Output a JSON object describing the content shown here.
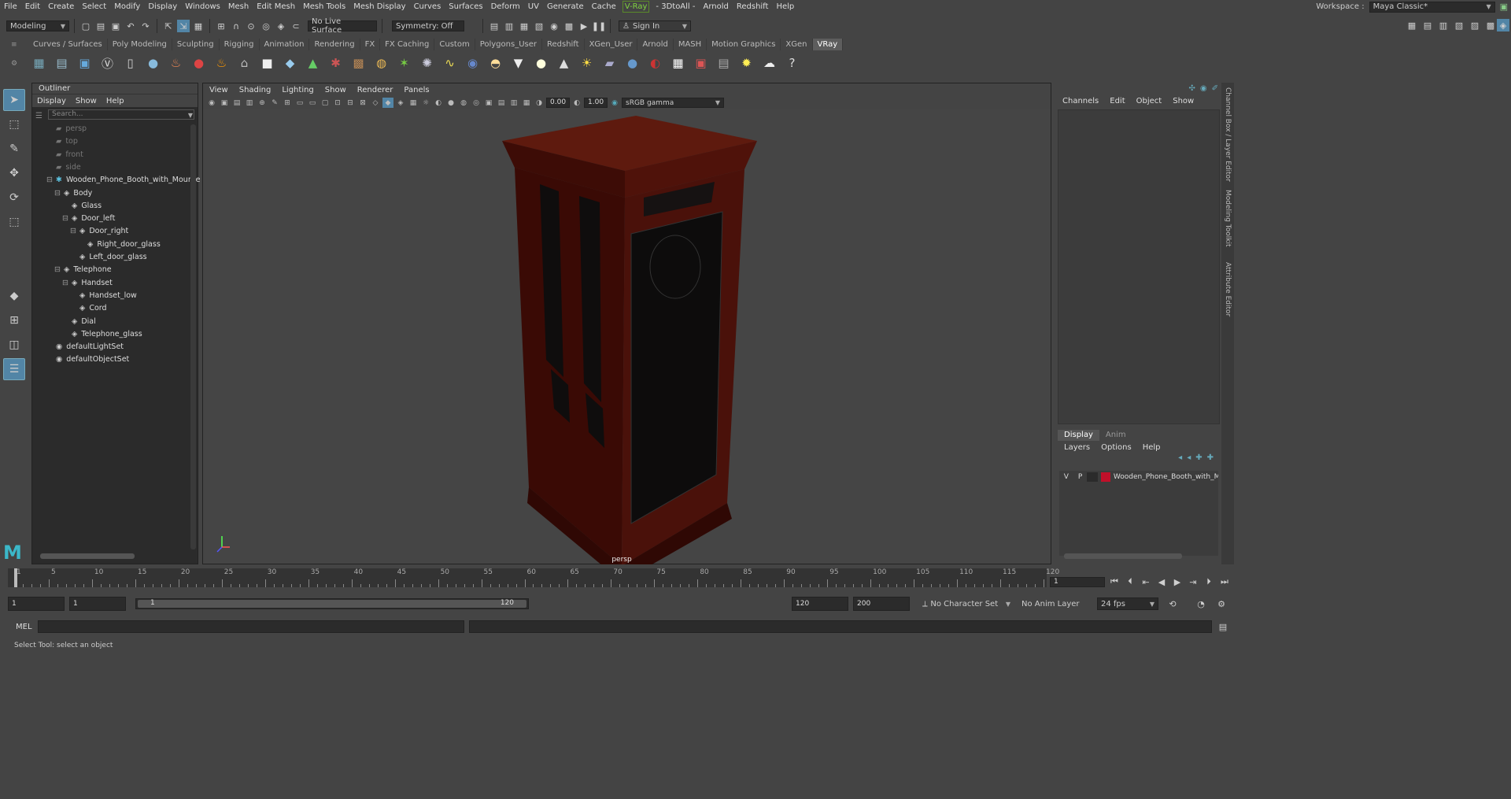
{
  "menu": [
    "File",
    "Edit",
    "Create",
    "Select",
    "Modify",
    "Display",
    "Windows",
    "Mesh",
    "Edit Mesh",
    "Mesh Tools",
    "Mesh Display",
    "Curves",
    "Surfaces",
    "Deform",
    "UV",
    "Generate",
    "Cache",
    "V-Ray",
    "- 3DtoAll -",
    "Arnold",
    "Redshift",
    "Help"
  ],
  "workspace": {
    "label": "Workspace :",
    "value": "Maya Classic*"
  },
  "toolbar": {
    "mode": "Modeling",
    "live_surface": "No Live Surface",
    "symmetry": "Symmetry: Off",
    "sign_in": "Sign In"
  },
  "shelf_tabs": [
    "Curves / Surfaces",
    "Poly Modeling",
    "Sculpting",
    "Rigging",
    "Animation",
    "Rendering",
    "FX",
    "FX Caching",
    "Custom",
    "Polygons_User",
    "Redshift",
    "XGen_User",
    "Arnold",
    "MASH",
    "Motion Graphics",
    "XGen",
    "VRay"
  ],
  "active_shelf_tab": "VRay",
  "outliner": {
    "title": "Outliner",
    "menu": [
      "Display",
      "Show",
      "Help"
    ],
    "search_placeholder": "Search...",
    "items": [
      {
        "label": "persp",
        "depth": 0,
        "kind": "camera"
      },
      {
        "label": "top",
        "depth": 0,
        "kind": "camera"
      },
      {
        "label": "front",
        "depth": 0,
        "kind": "camera"
      },
      {
        "label": "side",
        "depth": 0,
        "kind": "camera"
      },
      {
        "label": "Wooden_Phone_Booth_with_Mounte",
        "depth": 0,
        "kind": "group"
      },
      {
        "label": "Body",
        "depth": 1,
        "kind": "mesh"
      },
      {
        "label": "Glass",
        "depth": 2,
        "kind": "mesh"
      },
      {
        "label": "Door_left",
        "depth": 2,
        "kind": "mesh"
      },
      {
        "label": "Door_right",
        "depth": 3,
        "kind": "mesh"
      },
      {
        "label": "Right_door_glass",
        "depth": 4,
        "kind": "mesh"
      },
      {
        "label": "Left_door_glass",
        "depth": 3,
        "kind": "mesh"
      },
      {
        "label": "Telephone",
        "depth": 1,
        "kind": "mesh"
      },
      {
        "label": "Handset",
        "depth": 2,
        "kind": "mesh"
      },
      {
        "label": "Handset_low",
        "depth": 3,
        "kind": "mesh"
      },
      {
        "label": "Cord",
        "depth": 3,
        "kind": "mesh"
      },
      {
        "label": "Dial",
        "depth": 2,
        "kind": "mesh"
      },
      {
        "label": "Telephone_glass",
        "depth": 2,
        "kind": "mesh"
      },
      {
        "label": "defaultLightSet",
        "depth": 0,
        "kind": "set"
      },
      {
        "label": "defaultObjectSet",
        "depth": 0,
        "kind": "set"
      }
    ]
  },
  "viewport": {
    "menu": [
      "View",
      "Shading",
      "Lighting",
      "Show",
      "Renderer",
      "Panels"
    ],
    "exposure": "0.00",
    "gamma": "1.00",
    "color_space": "sRGB gamma",
    "camera_label": "persp"
  },
  "channel_box": {
    "menu": [
      "Channels",
      "Edit",
      "Object",
      "Show"
    ],
    "layer_tabs": [
      "Display",
      "Anim"
    ],
    "layer_menu": [
      "Layers",
      "Options",
      "Help"
    ],
    "layer": {
      "v": "V",
      "p": "P",
      "name": "Wooden_Phone_Booth_with_M",
      "color": "#c0102a"
    },
    "side_tabs": [
      "Channel Box / Layer Editor",
      "Modeling Toolkit",
      "Attribute Editor"
    ]
  },
  "timeline": {
    "ticks": [
      1,
      5,
      10,
      15,
      20,
      25,
      30,
      35,
      40,
      45,
      50,
      55,
      60,
      65,
      70,
      75,
      80,
      85,
      90,
      95,
      100,
      105,
      110,
      115,
      120
    ],
    "current_frame": "1",
    "max": 120
  },
  "range": {
    "start": "1",
    "start2": "1",
    "range_start": "1",
    "range_end": "120",
    "end": "120",
    "end2": "200",
    "character_set": "No Character Set",
    "anim_layer": "No Anim Layer",
    "fps": "24 fps"
  },
  "command": {
    "label": "MEL"
  },
  "status": "Select Tool: select an object"
}
